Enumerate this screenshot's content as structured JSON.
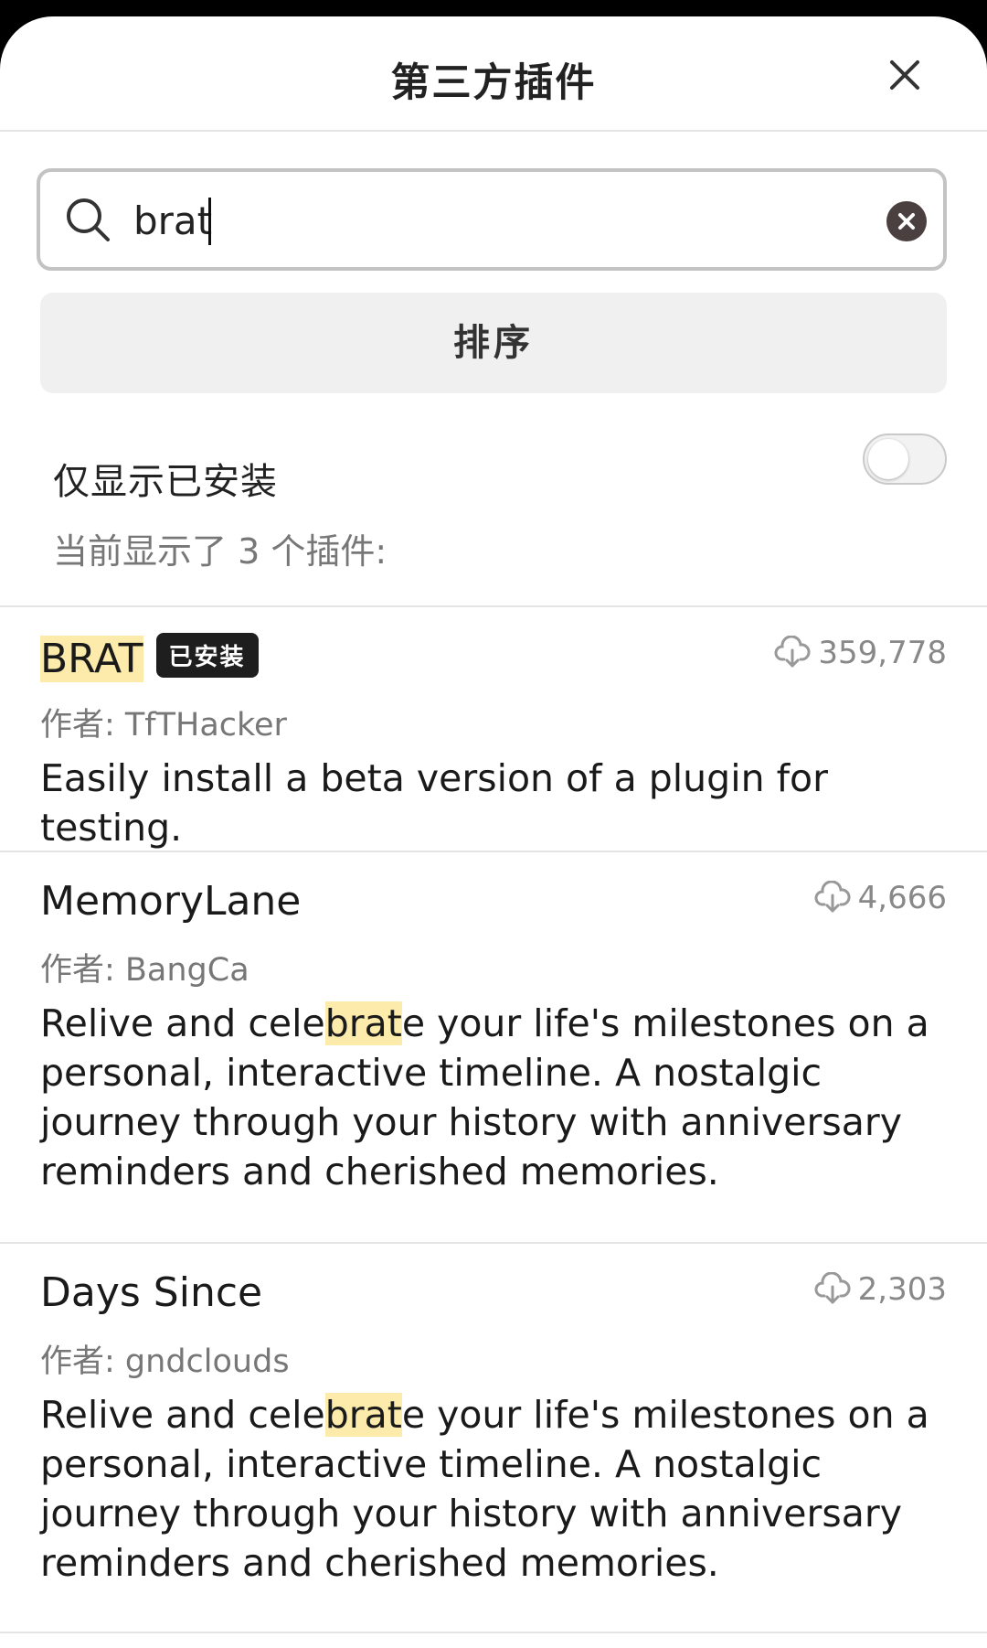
{
  "header": {
    "title": "第三方插件"
  },
  "search": {
    "value": "brat"
  },
  "sort": {
    "label": "排序"
  },
  "filter": {
    "label": "仅显示已安装",
    "enabled": false
  },
  "results": {
    "summary": "当前显示了 3 个插件:"
  },
  "plugins": [
    {
      "name_hl": "BRAT",
      "installed_badge": "已安装",
      "downloads": "359,778",
      "author": "作者: TfTHacker",
      "description": "Easily install a beta version of a plugin for testing."
    },
    {
      "name": "MemoryLane",
      "downloads": "4,666",
      "author": "作者: BangCa",
      "desc_pre": "Relive and cele",
      "desc_hl": "brat",
      "desc_post": "e your life's milestones on a personal, interactive timeline. A nostalgic journey through your history with anniversary reminders and cherished memories."
    },
    {
      "name": "Days Since",
      "downloads": "2,303",
      "author": "作者: gndclouds",
      "desc_pre": "Relive and cele",
      "desc_hl": "brat",
      "desc_post": "e your life's milestones on a personal, interactive timeline. A nostalgic journey through your history with anniversary reminders and cherished memories."
    }
  ],
  "colors": {
    "highlight": "#fcebaa",
    "badge_bg": "#1e1e1e",
    "sort_bg": "#f0f0f0"
  }
}
